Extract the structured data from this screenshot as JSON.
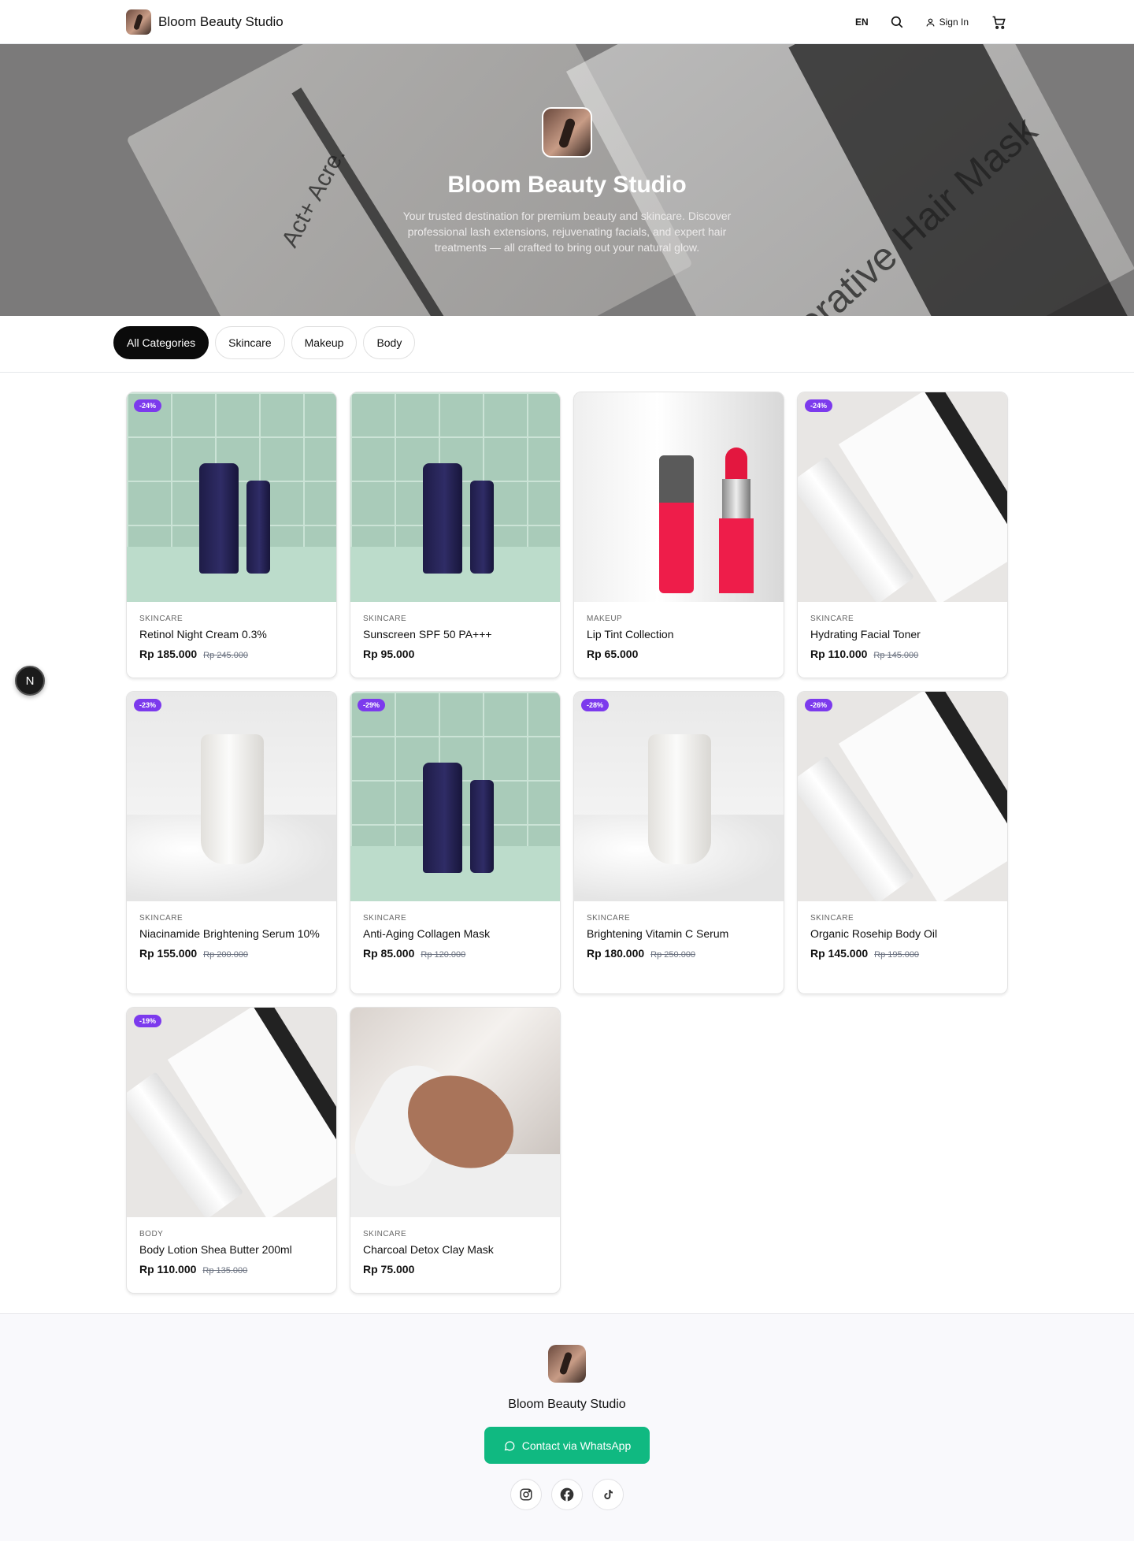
{
  "header": {
    "brand_name": "Bloom Beauty Studio",
    "language": "EN",
    "sign_in": "Sign In"
  },
  "hero": {
    "title": "Bloom Beauty Studio",
    "description": "Your trusted destination for premium beauty and skincare. Discover professional lash extensions, rejuvenating facials, and expert hair treatments — all crafted to bring out your natural glow.",
    "background_text_a": "Act+ Acre.",
    "background_text_b": "Restorative Hair Mask"
  },
  "categories": [
    "All Categories",
    "Skincare",
    "Makeup",
    "Body"
  ],
  "active_category": "All Categories",
  "products": [
    {
      "category": "SKINCARE",
      "name": "Retinol Night Cream 0.3%",
      "price": "Rp 185.000",
      "old_price": "Rp 245.000",
      "discount": "-24%",
      "image": "tile-tubes"
    },
    {
      "category": "SKINCARE",
      "name": "Sunscreen SPF 50 PA+++",
      "price": "Rp 95.000",
      "old_price": "",
      "discount": "",
      "image": "tile-tubes"
    },
    {
      "category": "MAKEUP",
      "name": "Lip Tint Collection",
      "price": "Rp 65.000",
      "old_price": "",
      "discount": "",
      "image": "lipstick"
    },
    {
      "category": "SKINCARE",
      "name": "Hydrating Facial Toner",
      "price": "Rp 110.000",
      "old_price": "Rp 145.000",
      "discount": "-24%",
      "image": "act-acre"
    },
    {
      "category": "SKINCARE",
      "name": "Niacinamide Brightening Serum 10%",
      "price": "Rp 155.000",
      "old_price": "Rp 200.000",
      "discount": "-23%",
      "image": "lotion"
    },
    {
      "category": "SKINCARE",
      "name": "Anti-Aging Collagen Mask",
      "price": "Rp 85.000",
      "old_price": "Rp 120.000",
      "discount": "-29%",
      "image": "tile-tubes"
    },
    {
      "category": "SKINCARE",
      "name": "Brightening Vitamin C Serum",
      "price": "Rp 180.000",
      "old_price": "Rp 250.000",
      "discount": "-28%",
      "image": "lotion"
    },
    {
      "category": "SKINCARE",
      "name": "Organic Rosehip Body Oil",
      "price": "Rp 145.000",
      "old_price": "Rp 195.000",
      "discount": "-26%",
      "image": "act-acre"
    },
    {
      "category": "BODY",
      "name": "Body Lotion Shea Butter 200ml",
      "price": "Rp 110.000",
      "old_price": "Rp 135.000",
      "discount": "-19%",
      "image": "act-acre"
    },
    {
      "category": "SKINCARE",
      "name": "Charcoal Detox Clay Mask",
      "price": "Rp 75.000",
      "old_price": "",
      "discount": "",
      "image": "facial"
    }
  ],
  "floating_badge": "N",
  "footer": {
    "brand_name": "Bloom Beauty Studio",
    "whatsapp_label": "Contact via WhatsApp",
    "socials": [
      "instagram-icon",
      "facebook-icon",
      "tiktok-icon"
    ]
  },
  "colors": {
    "accent_purple": "#7c3aed",
    "whatsapp_green": "#10b981",
    "chip_active": "#0b0b0b"
  }
}
